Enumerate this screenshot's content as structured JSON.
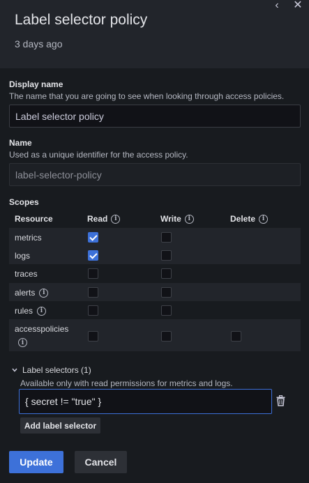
{
  "header": {
    "title": "Label selector policy",
    "subtitle": "3 days ago"
  },
  "display_name": {
    "label": "Display name",
    "description": "The name that you are going to see when looking through access policies.",
    "value": "Label selector policy"
  },
  "name_field": {
    "label": "Name",
    "description": "Used as a unique identifier for the access policy.",
    "value": "label-selector-policy"
  },
  "scopes": {
    "label": "Scopes",
    "columns": [
      "Resource",
      "Read",
      "Write",
      "Delete"
    ],
    "rows": [
      {
        "name": "metrics",
        "read": true,
        "write": false,
        "delete": null,
        "info": false
      },
      {
        "name": "logs",
        "read": true,
        "write": false,
        "delete": null,
        "info": false
      },
      {
        "name": "traces",
        "read": false,
        "write": false,
        "delete": null,
        "info": false
      },
      {
        "name": "alerts",
        "read": false,
        "write": false,
        "delete": null,
        "info": true
      },
      {
        "name": "rules",
        "read": false,
        "write": false,
        "delete": null,
        "info": true
      },
      {
        "name": "accesspolicies",
        "read": false,
        "write": false,
        "delete": false,
        "info": true
      }
    ]
  },
  "label_selectors": {
    "title": "Label selectors (1)",
    "description": "Available only with read permissions for metrics and logs.",
    "value": "{ secret != \"true\" }",
    "add_label": "Add label selector"
  },
  "actions": {
    "update": "Update",
    "cancel": "Cancel"
  },
  "colors": {
    "accent": "#3d71d9",
    "background": "#181b1f",
    "header": "#22252b"
  }
}
